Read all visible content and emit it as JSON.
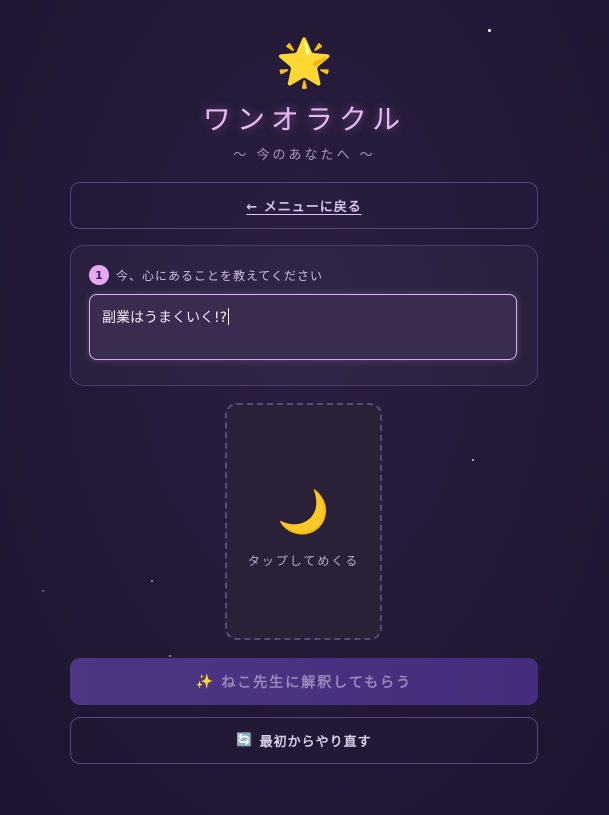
{
  "header": {
    "icon": "🌟",
    "title": "ワンオラクル",
    "subtitle": "〜 今のあなたへ 〜"
  },
  "nav": {
    "back_label": "← メニューに戻る"
  },
  "question": {
    "step_number": "1",
    "step_label": "今、心にあることを教えてください",
    "input_value": "副業はうまくいく!?"
  },
  "card": {
    "icon": "🌙",
    "label": "タップしてめくる"
  },
  "actions": {
    "interpret_icon": "✨",
    "interpret_label": "ねこ先生に解釈してもらう",
    "restart_icon": "🔄",
    "restart_label": "最初からやり直す"
  },
  "colors": {
    "background": "#251a38",
    "accent": "#e6a8f2",
    "primary_button": "#4d3784"
  },
  "icons": [
    "star-icon",
    "crescent-moon-icon",
    "sparkles-icon",
    "refresh-icon"
  ]
}
